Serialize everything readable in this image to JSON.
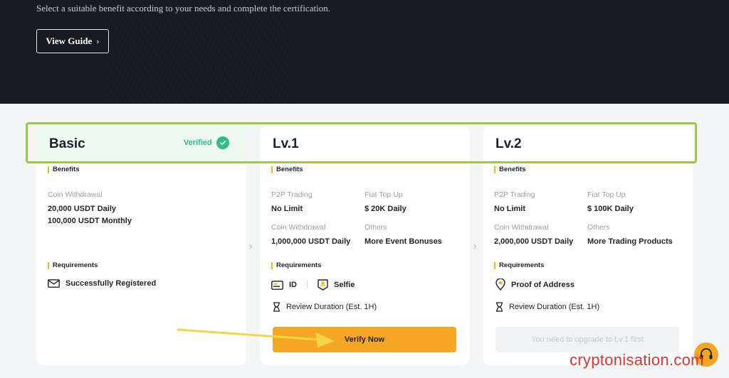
{
  "hero": {
    "subtitle": "Select a suitable benefit according to your needs and complete the certification.",
    "guide_button": "View Guide"
  },
  "cards": [
    {
      "title": "Basic",
      "status": "Verified",
      "benefits_label": "Benefits",
      "benefits": [
        {
          "label": "Coin Withdrawal",
          "value": "20,000 USDT Daily",
          "value2": "100,000 USDT Monthly"
        }
      ],
      "requirements_label": "Requirements",
      "requirements": [
        "Successfully Registered"
      ]
    },
    {
      "title": "Lv.1",
      "benefits_label": "Benefits",
      "benefits": [
        {
          "label": "P2P Trading",
          "value": "No Limit"
        },
        {
          "label": "Fiat Top Up",
          "value": "$ 20K Daily"
        },
        {
          "label": "Coin Withdrawal",
          "value": "1,000,000 USDT Daily"
        },
        {
          "label": "Others",
          "value": "More Event Bonuses"
        }
      ],
      "requirements_label": "Requirements",
      "requirements": [
        "ID",
        "Selfie"
      ],
      "review": "Review Duration (Est. 1H)",
      "action": "Verify Now"
    },
    {
      "title": "Lv.2",
      "benefits_label": "Benefits",
      "benefits": [
        {
          "label": "P2P Trading",
          "value": "No Limit"
        },
        {
          "label": "Fiat Top Up",
          "value": "$ 100K Daily"
        },
        {
          "label": "Coin Withdrawal",
          "value": "2,000,000 USDT Daily"
        },
        {
          "label": "Others",
          "value": "More Trading Products"
        }
      ],
      "requirements_label": "Requirements",
      "requirements": [
        "Proof of Address"
      ],
      "review": "Review Duration (Est. 1H)",
      "action": "You need to upgrade to Lv.1 first"
    }
  ],
  "icons": {
    "chevron": "chevron-right-icon",
    "verified": "check-circle-icon",
    "support": "headset-icon"
  },
  "colors": {
    "accent": "#f5a623",
    "verified": "#2ebd85",
    "highlight": "#9bc93f",
    "annotation_arrow": "#f5d547",
    "watermark": "#e0312b"
  },
  "watermark": "cryptonisation.com"
}
